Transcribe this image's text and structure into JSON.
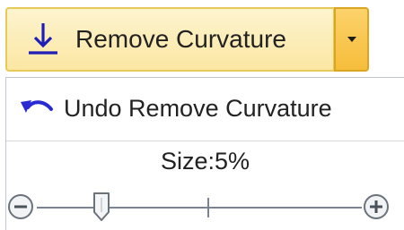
{
  "split_button": {
    "label": "Remove Curvature",
    "icon": "down-arrow-underline-icon",
    "dropdown_icon": "triangle-down-icon"
  },
  "menu": {
    "undo_label": "Undo Remove Curvature",
    "undo_icon": "undo-arrow-icon"
  },
  "size": {
    "label": "Size:5%",
    "value_percent": 5
  },
  "slider": {
    "zoom_out_icon": "minus-circle-icon",
    "zoom_in_icon": "plus-circle-icon",
    "thumb_fraction": 0.2
  },
  "colors": {
    "button_border": "#e7c95a",
    "button_fill_top": "#fdf4cf",
    "dropdown_fill": "#f6bd3b",
    "icon_blue": "#2a2ad2",
    "track": "#7b8591"
  }
}
